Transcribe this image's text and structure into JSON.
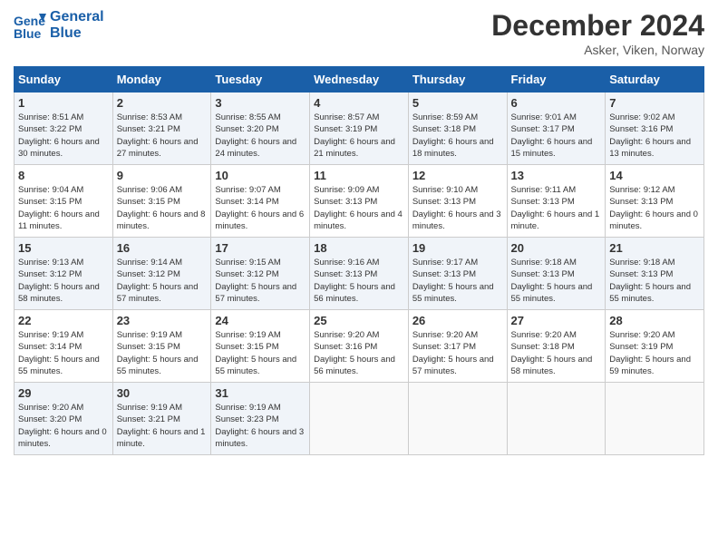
{
  "header": {
    "logo_line1": "General",
    "logo_line2": "Blue",
    "month_title": "December 2024",
    "location": "Asker, Viken, Norway"
  },
  "days_of_week": [
    "Sunday",
    "Monday",
    "Tuesday",
    "Wednesday",
    "Thursday",
    "Friday",
    "Saturday"
  ],
  "weeks": [
    [
      {
        "day": 1,
        "sunrise": "Sunrise: 8:51 AM",
        "sunset": "Sunset: 3:22 PM",
        "daylight": "Daylight: 6 hours and 30 minutes."
      },
      {
        "day": 2,
        "sunrise": "Sunrise: 8:53 AM",
        "sunset": "Sunset: 3:21 PM",
        "daylight": "Daylight: 6 hours and 27 minutes."
      },
      {
        "day": 3,
        "sunrise": "Sunrise: 8:55 AM",
        "sunset": "Sunset: 3:20 PM",
        "daylight": "Daylight: 6 hours and 24 minutes."
      },
      {
        "day": 4,
        "sunrise": "Sunrise: 8:57 AM",
        "sunset": "Sunset: 3:19 PM",
        "daylight": "Daylight: 6 hours and 21 minutes."
      },
      {
        "day": 5,
        "sunrise": "Sunrise: 8:59 AM",
        "sunset": "Sunset: 3:18 PM",
        "daylight": "Daylight: 6 hours and 18 minutes."
      },
      {
        "day": 6,
        "sunrise": "Sunrise: 9:01 AM",
        "sunset": "Sunset: 3:17 PM",
        "daylight": "Daylight: 6 hours and 15 minutes."
      },
      {
        "day": 7,
        "sunrise": "Sunrise: 9:02 AM",
        "sunset": "Sunset: 3:16 PM",
        "daylight": "Daylight: 6 hours and 13 minutes."
      }
    ],
    [
      {
        "day": 8,
        "sunrise": "Sunrise: 9:04 AM",
        "sunset": "Sunset: 3:15 PM",
        "daylight": "Daylight: 6 hours and 11 minutes."
      },
      {
        "day": 9,
        "sunrise": "Sunrise: 9:06 AM",
        "sunset": "Sunset: 3:15 PM",
        "daylight": "Daylight: 6 hours and 8 minutes."
      },
      {
        "day": 10,
        "sunrise": "Sunrise: 9:07 AM",
        "sunset": "Sunset: 3:14 PM",
        "daylight": "Daylight: 6 hours and 6 minutes."
      },
      {
        "day": 11,
        "sunrise": "Sunrise: 9:09 AM",
        "sunset": "Sunset: 3:13 PM",
        "daylight": "Daylight: 6 hours and 4 minutes."
      },
      {
        "day": 12,
        "sunrise": "Sunrise: 9:10 AM",
        "sunset": "Sunset: 3:13 PM",
        "daylight": "Daylight: 6 hours and 3 minutes."
      },
      {
        "day": 13,
        "sunrise": "Sunrise: 9:11 AM",
        "sunset": "Sunset: 3:13 PM",
        "daylight": "Daylight: 6 hours and 1 minute."
      },
      {
        "day": 14,
        "sunrise": "Sunrise: 9:12 AM",
        "sunset": "Sunset: 3:13 PM",
        "daylight": "Daylight: 6 hours and 0 minutes."
      }
    ],
    [
      {
        "day": 15,
        "sunrise": "Sunrise: 9:13 AM",
        "sunset": "Sunset: 3:12 PM",
        "daylight": "Daylight: 5 hours and 58 minutes."
      },
      {
        "day": 16,
        "sunrise": "Sunrise: 9:14 AM",
        "sunset": "Sunset: 3:12 PM",
        "daylight": "Daylight: 5 hours and 57 minutes."
      },
      {
        "day": 17,
        "sunrise": "Sunrise: 9:15 AM",
        "sunset": "Sunset: 3:12 PM",
        "daylight": "Daylight: 5 hours and 57 minutes."
      },
      {
        "day": 18,
        "sunrise": "Sunrise: 9:16 AM",
        "sunset": "Sunset: 3:13 PM",
        "daylight": "Daylight: 5 hours and 56 minutes."
      },
      {
        "day": 19,
        "sunrise": "Sunrise: 9:17 AM",
        "sunset": "Sunset: 3:13 PM",
        "daylight": "Daylight: 5 hours and 55 minutes."
      },
      {
        "day": 20,
        "sunrise": "Sunrise: 9:18 AM",
        "sunset": "Sunset: 3:13 PM",
        "daylight": "Daylight: 5 hours and 55 minutes."
      },
      {
        "day": 21,
        "sunrise": "Sunrise: 9:18 AM",
        "sunset": "Sunset: 3:13 PM",
        "daylight": "Daylight: 5 hours and 55 minutes."
      }
    ],
    [
      {
        "day": 22,
        "sunrise": "Sunrise: 9:19 AM",
        "sunset": "Sunset: 3:14 PM",
        "daylight": "Daylight: 5 hours and 55 minutes."
      },
      {
        "day": 23,
        "sunrise": "Sunrise: 9:19 AM",
        "sunset": "Sunset: 3:15 PM",
        "daylight": "Daylight: 5 hours and 55 minutes."
      },
      {
        "day": 24,
        "sunrise": "Sunrise: 9:19 AM",
        "sunset": "Sunset: 3:15 PM",
        "daylight": "Daylight: 5 hours and 55 minutes."
      },
      {
        "day": 25,
        "sunrise": "Sunrise: 9:20 AM",
        "sunset": "Sunset: 3:16 PM",
        "daylight": "Daylight: 5 hours and 56 minutes."
      },
      {
        "day": 26,
        "sunrise": "Sunrise: 9:20 AM",
        "sunset": "Sunset: 3:17 PM",
        "daylight": "Daylight: 5 hours and 57 minutes."
      },
      {
        "day": 27,
        "sunrise": "Sunrise: 9:20 AM",
        "sunset": "Sunset: 3:18 PM",
        "daylight": "Daylight: 5 hours and 58 minutes."
      },
      {
        "day": 28,
        "sunrise": "Sunrise: 9:20 AM",
        "sunset": "Sunset: 3:19 PM",
        "daylight": "Daylight: 5 hours and 59 minutes."
      }
    ],
    [
      {
        "day": 29,
        "sunrise": "Sunrise: 9:20 AM",
        "sunset": "Sunset: 3:20 PM",
        "daylight": "Daylight: 6 hours and 0 minutes."
      },
      {
        "day": 30,
        "sunrise": "Sunrise: 9:19 AM",
        "sunset": "Sunset: 3:21 PM",
        "daylight": "Daylight: 6 hours and 1 minute."
      },
      {
        "day": 31,
        "sunrise": "Sunrise: 9:19 AM",
        "sunset": "Sunset: 3:23 PM",
        "daylight": "Daylight: 6 hours and 3 minutes."
      },
      null,
      null,
      null,
      null
    ]
  ]
}
